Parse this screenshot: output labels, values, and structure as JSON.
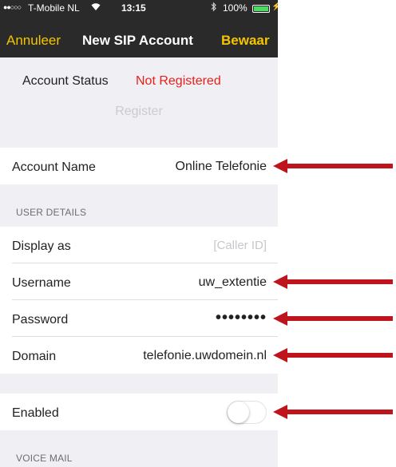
{
  "status_bar": {
    "signal": "●●○○○",
    "carrier": "T-Mobile NL",
    "wifi_icon": "wifi-icon",
    "time": "13:15",
    "bluetooth_icon": "bluetooth-icon",
    "battery": "100%"
  },
  "nav": {
    "cancel": "Annuleer",
    "title": "New SIP Account",
    "save": "Bewaar"
  },
  "account_status": {
    "label": "Account Status",
    "value": "Not Registered"
  },
  "register_button": "Register",
  "account_name": {
    "label": "Account Name",
    "value": "Online Telefonie"
  },
  "user_details": {
    "header": "USER DETAILS",
    "display_as": {
      "label": "Display as",
      "placeholder": "[Caller ID]"
    },
    "username": {
      "label": "Username",
      "value": "uw_extentie"
    },
    "password": {
      "label": "Password",
      "value": "••••••••"
    },
    "domain": {
      "label": "Domain",
      "value": "telefonie.uwdomein.nl"
    }
  },
  "enabled": {
    "label": "Enabled",
    "on": false
  },
  "voice_mail": {
    "header": "VOICE MAIL"
  },
  "colors": {
    "accent": "#f5c400",
    "error": "#e8201a",
    "arrow": "#c0141c"
  }
}
